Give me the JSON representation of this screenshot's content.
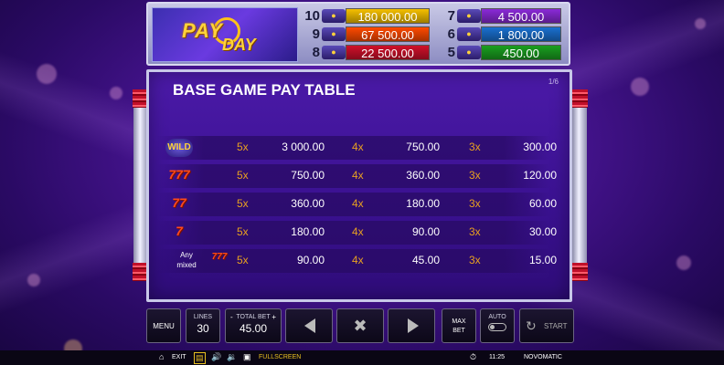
{
  "game": {
    "logo_line1": "PAY",
    "logo_line2": "DAY"
  },
  "jackpots": [
    {
      "num": "10",
      "value": "180 000.00",
      "color": "#f5c000"
    },
    {
      "num": "9",
      "value": "67 500.00",
      "color": "#ff4a00"
    },
    {
      "num": "8",
      "value": "22 500.00",
      "color": "#d0102a"
    },
    {
      "num": "7",
      "value": "4 500.00",
      "color": "#8a2ad8"
    },
    {
      "num": "6",
      "value": "1 800.00",
      "color": "#1a70d0"
    },
    {
      "num": "5",
      "value": "450.00",
      "color": "#1aa020"
    }
  ],
  "paytable": {
    "title": "BASE GAME PAY TABLE",
    "page": "1/6",
    "any_mixed": "Any\nmixed",
    "rows": [
      {
        "symbol": "WILD",
        "symbol_icon": "wild-icon",
        "m1": "5x",
        "v1": "3 000.00",
        "m2": "4x",
        "v2": "750.00",
        "m3": "3x",
        "v3": "300.00"
      },
      {
        "symbol": "777",
        "symbol_icon": "triple-red-seven-icon",
        "m1": "5x",
        "v1": "750.00",
        "m2": "4x",
        "v2": "360.00",
        "m3": "3x",
        "v3": "120.00"
      },
      {
        "symbol": "77",
        "symbol_icon": "double-red-seven-icon",
        "m1": "5x",
        "v1": "360.00",
        "m2": "4x",
        "v2": "180.00",
        "m3": "3x",
        "v3": "60.00"
      },
      {
        "symbol": "7",
        "symbol_icon": "single-red-seven-icon",
        "m1": "5x",
        "v1": "180.00",
        "m2": "4x",
        "v2": "90.00",
        "m3": "3x",
        "v3": "30.00"
      },
      {
        "symbol": "777",
        "symbol_icon": "mixed-sevens-icon",
        "m1": "5x",
        "v1": "90.00",
        "m2": "4x",
        "v2": "45.00",
        "m3": "3x",
        "v3": "15.00"
      }
    ]
  },
  "controls": {
    "menu": "MENU",
    "lines_label": "LINES",
    "lines_value": "30",
    "total_bet_label": "TOTAL BET",
    "total_bet_value": "45.00",
    "minus": "-",
    "plus": "+",
    "prev_icon": "triangle-left-icon",
    "close_icon": "x-close-icon",
    "next_icon": "triangle-right-icon",
    "max_bet": "MAX\nBET",
    "auto": "AUTO",
    "start": "START"
  },
  "status": {
    "exit": "EXIT",
    "fullscreen": "FULLSCREEN",
    "time": "11:25",
    "brand": "NOVOMATIC"
  }
}
